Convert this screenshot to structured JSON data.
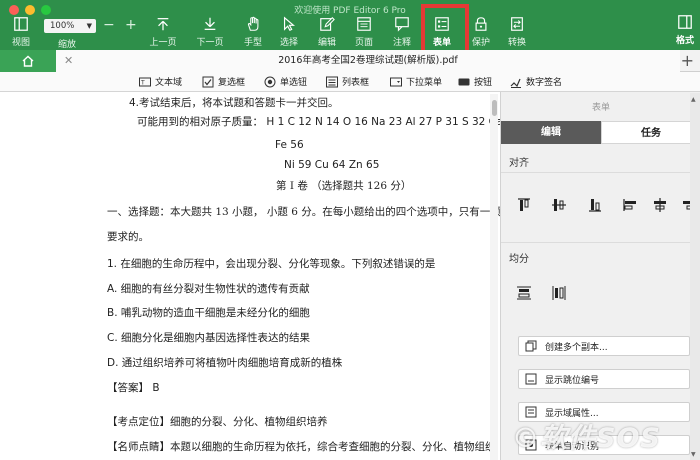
{
  "window": {
    "title": "欢迎使用 PDF Editor 6 Pro"
  },
  "toolbar": {
    "view_label": "视图",
    "zoom_value": "100%",
    "zoom_label": "缩放",
    "items": [
      {
        "id": "prev-page",
        "label": "上一页",
        "icon": "arrow-up-icon"
      },
      {
        "id": "next-page",
        "label": "下一页",
        "icon": "arrow-down-icon"
      },
      {
        "id": "hand",
        "label": "手型",
        "icon": "hand-icon"
      },
      {
        "id": "select",
        "label": "选择",
        "icon": "cursor-icon"
      },
      {
        "id": "edit",
        "label": "编辑",
        "icon": "pencil-icon"
      },
      {
        "id": "page",
        "label": "页面",
        "icon": "page-icon"
      },
      {
        "id": "annotate",
        "label": "注释",
        "icon": "comment-icon"
      },
      {
        "id": "form",
        "label": "表单",
        "icon": "form-icon"
      },
      {
        "id": "protect",
        "label": "保护",
        "icon": "lock-icon"
      },
      {
        "id": "convert",
        "label": "转换",
        "icon": "convert-icon"
      }
    ],
    "format_label": "格式"
  },
  "tabs": {
    "document_title": "2016年高考全国2卷理综试题(解析版).pdf"
  },
  "form_tools": [
    {
      "label": "文本域",
      "icon": "text-field-icon"
    },
    {
      "label": "复选框",
      "icon": "checkbox-icon"
    },
    {
      "label": "单选钮",
      "icon": "radio-button-icon"
    },
    {
      "label": "列表框",
      "icon": "list-box-icon"
    },
    {
      "label": "下拉菜单",
      "icon": "dropdown-icon"
    },
    {
      "label": "按钮",
      "icon": "button-icon"
    },
    {
      "label": "数字签名",
      "icon": "signature-icon"
    }
  ],
  "document": {
    "lines": [
      "4.考试结束后，将本试题和答题卡一并交回。",
      "可能用到的相对原子质量： H 1 C 12 N 14 O 16 Na 23 Al 27 P 31 S 32 Ca 4",
      "Fe 56",
      "Ni 59 Cu 64 Zn 65",
      "第 I 卷 （选择题共 126 分）",
      "一、选择题：本大题共 13 小题， 小题 6 分。在每小题给出的四个选项中，只有一项",
      "要求的。",
      "1. 在细胞的生命历程中，会出现分裂、分化等现象。下列叙述错误的是",
      "A. 细胞的有丝分裂对生物性状的遗传有贡献",
      "B. 哺乳动物的造血干细胞是未经分化的细胞",
      "C. 细胞分化是细胞内基因选择性表达的结果",
      "D. 通过组织培养可将植物叶肉细胞培育成新的植株",
      "【答案】 B",
      "【考点定位】细胞的分裂、分化、植物组织培养",
      "【名师点睛】本题以细胞的生命历程为依托，综合考查细胞的分裂、分化、植物组织"
    ]
  },
  "panel": {
    "title": "表单",
    "tabs": [
      {
        "label": "编辑",
        "active": true
      },
      {
        "label": "任务",
        "active": false
      }
    ],
    "align_label": "对齐",
    "distribute_label": "均分",
    "buttons": [
      {
        "label": "创建多个副本..."
      },
      {
        "label": "显示跳位编号"
      },
      {
        "label": "显示域属性..."
      },
      {
        "label": "表单自动识别"
      }
    ]
  },
  "watermark": {
    "text": "©软件SOS"
  },
  "colors": {
    "toolbar_green": "#2e8f4a",
    "tab_green": "#3aa356",
    "highlight_red": "#e53935",
    "panel_tab_active": "#5a5a5a"
  }
}
